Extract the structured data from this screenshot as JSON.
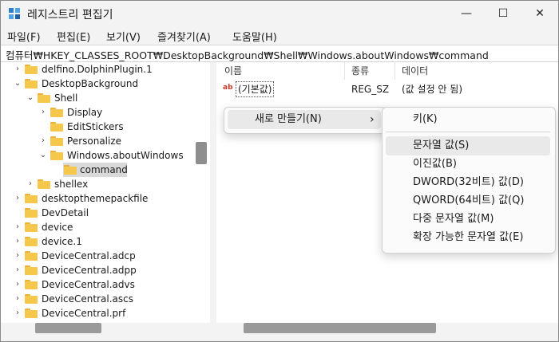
{
  "window": {
    "title": "레지스트리 편집기",
    "minimize_glyph": "—",
    "maximize_glyph": "☐",
    "close_glyph": "✕"
  },
  "menu": [
    "파일(F)",
    "편집(E)",
    "보기(V)",
    "즐겨찾기(A)",
    "도움말(H)"
  ],
  "address": "컴퓨터₩HKEY_CLASSES_ROOT₩DesktopBackground₩Shell₩Windows.aboutWindows₩command",
  "tree": [
    {
      "label": "delfino.DolphinPlugin.1",
      "chevron": "›"
    },
    {
      "label": "DesktopBackground",
      "chevron": "⌄"
    },
    {
      "label": "Shell",
      "chevron": "⌄"
    },
    {
      "label": "Display",
      "chevron": "›"
    },
    {
      "label": "EditStickers",
      "chevron": ""
    },
    {
      "label": "Personalize",
      "chevron": "›"
    },
    {
      "label": "Windows.aboutWindows",
      "chevron": "⌄"
    },
    {
      "label": "command",
      "chevron": "",
      "selected": true
    },
    {
      "label": "shellex",
      "chevron": "›"
    },
    {
      "label": "desktopthemepackfile",
      "chevron": "›"
    },
    {
      "label": "DevDetail",
      "chevron": ""
    },
    {
      "label": "device",
      "chevron": "›"
    },
    {
      "label": "device.1",
      "chevron": "›"
    },
    {
      "label": "DeviceCentral.adcp",
      "chevron": "›"
    },
    {
      "label": "DeviceCentral.adpp",
      "chevron": "›"
    },
    {
      "label": "DeviceCentral.advs",
      "chevron": "›"
    },
    {
      "label": "DeviceCentral.ascs",
      "chevron": "›"
    },
    {
      "label": "DeviceCentral.prf",
      "chevron": "›"
    }
  ],
  "columns": {
    "name": "이름",
    "type": "종류",
    "data": "데이터"
  },
  "row": {
    "name": "(기본값)",
    "type": "REG_SZ",
    "data": "(값 설정 안 됨)",
    "icon": "ab"
  },
  "context_menu": {
    "new_label": "새로 만들기(N)",
    "arrow": "›"
  },
  "submenu": [
    "키(K)",
    "문자열 값(S)",
    "이진값(B)",
    "DWORD(32비트) 값(D)",
    "QWORD(64비트) 값(Q)",
    "다중 문자열 값(M)",
    "확장 가능한 문자열 값(E)"
  ],
  "colors": {
    "folder": "#f5c84c",
    "selection": "#d9d9d9",
    "accent": "#e8b33a"
  }
}
